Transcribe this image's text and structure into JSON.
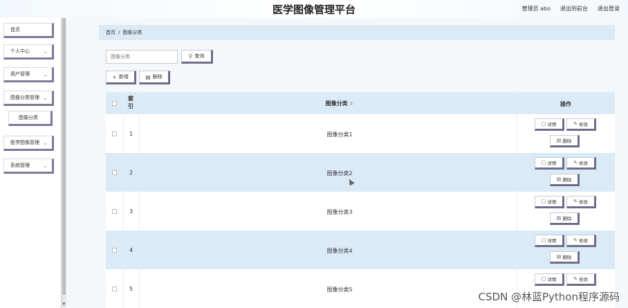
{
  "header": {
    "title": "医学图像管理平台",
    "admin": "管理员 abo",
    "exit_front": "退出到前台",
    "logout": "退出登录"
  },
  "sidebar": {
    "items": [
      {
        "label": "首页",
        "chevron": ""
      },
      {
        "label": "个人中心",
        "chevron": "⌄"
      },
      {
        "label": "用户管理",
        "chevron": "⌄"
      },
      {
        "label": "图像分类管理",
        "chevron": "⌄"
      },
      {
        "label": "图像分类",
        "chevron": ""
      },
      {
        "label": "医学图像管理",
        "chevron": "⌄"
      },
      {
        "label": "系统管理",
        "chevron": "⌄"
      }
    ]
  },
  "breadcrumb": {
    "home": "首页",
    "sep": "/",
    "current": "图像分类"
  },
  "search": {
    "placeholder": "图像分类",
    "button_label": "查询"
  },
  "toolbar": {
    "add_label": "新增",
    "delete_label": "删除"
  },
  "table": {
    "headers": {
      "index": "索引",
      "category": "图像分类",
      "sort_mark": "⇕",
      "ops": "操作"
    },
    "ops_labels": {
      "detail": "详情",
      "edit": "修改",
      "delete": "删除"
    },
    "rows": [
      {
        "index": "1",
        "category": "图像分类1"
      },
      {
        "index": "2",
        "category": "图像分类2"
      },
      {
        "index": "3",
        "category": "图像分类3"
      },
      {
        "index": "4",
        "category": "图像分类4"
      },
      {
        "index": "5",
        "category": "图像分类5"
      }
    ]
  },
  "watermark": "CSDN @林蓝Python程序源码",
  "colors": {
    "accent_light": "#dbeaf7",
    "button_shadow": "#6d6d8a"
  }
}
